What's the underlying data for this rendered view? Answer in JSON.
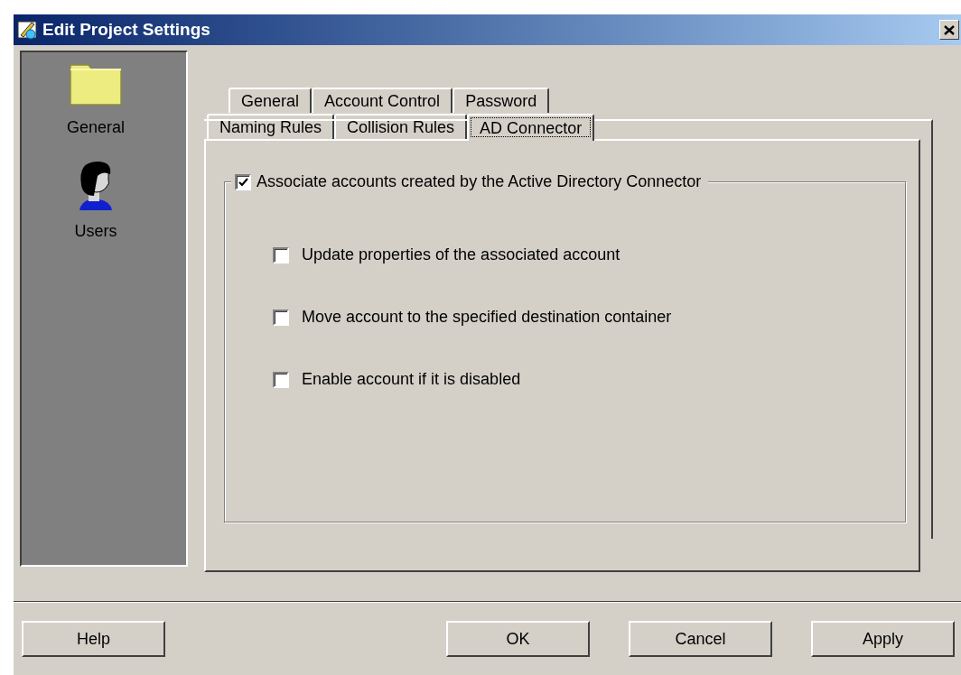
{
  "window": {
    "title": "Edit Project Settings"
  },
  "sidebar": {
    "items": [
      {
        "label": "General",
        "kind": "folder"
      },
      {
        "label": "Users",
        "kind": "user"
      }
    ]
  },
  "tab_rows": [
    {
      "tabs": [
        {
          "label": "General",
          "selected": false
        },
        {
          "label": "Account Control",
          "selected": false
        },
        {
          "label": "Password",
          "selected": false
        }
      ]
    },
    {
      "tabs": [
        {
          "label": "Naming Rules",
          "selected": false
        },
        {
          "label": "Collision Rules",
          "selected": false
        },
        {
          "label": "AD Connector",
          "selected": true
        }
      ]
    }
  ],
  "group": {
    "label": "Associate accounts created by the Active Directory Connector",
    "checked": true
  },
  "options": [
    {
      "label": "Update properties of the associated account",
      "checked": false
    },
    {
      "label": "Move account to the specified destination container",
      "checked": false
    },
    {
      "label": "Enable account if it is disabled",
      "checked": false
    }
  ],
  "buttons": [
    {
      "label": "Help"
    },
    {
      "label": "OK"
    },
    {
      "label": "Cancel"
    },
    {
      "label": "Apply"
    }
  ]
}
